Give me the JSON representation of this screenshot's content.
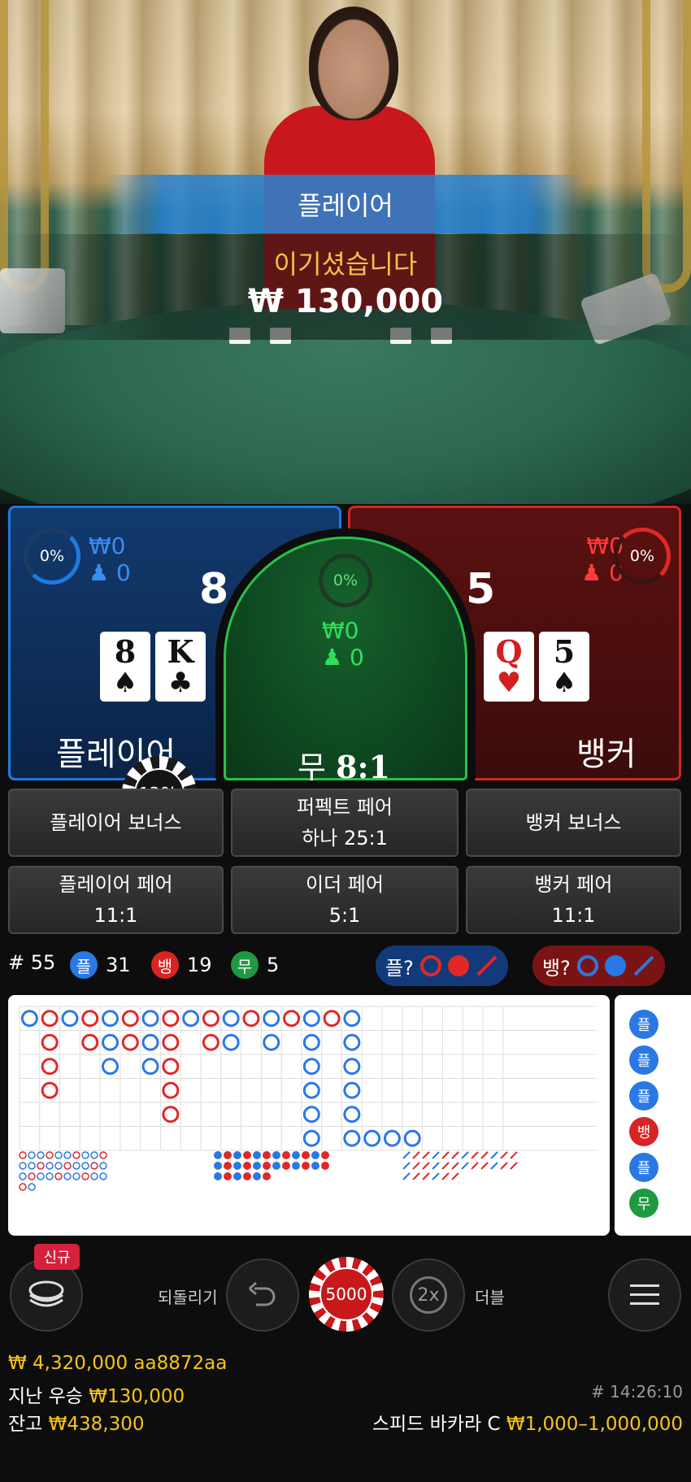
{
  "video": {
    "winner_banner": "플레이어",
    "win_label": "이기셨습니다",
    "win_amount": "₩ 130,000"
  },
  "player_panel": {
    "percent": "0%",
    "amount": "₩0",
    "players": "0",
    "score": "8",
    "cards": [
      {
        "rank": "8",
        "suit": "♠",
        "color": "black"
      },
      {
        "rank": "K",
        "suit": "♣",
        "color": "black"
      }
    ],
    "label": "플레이어",
    "color": "#1f7ae0"
  },
  "tie_panel": {
    "percent": "0%",
    "amount": "₩0",
    "players": "0",
    "label": "무",
    "payout": "8:1",
    "color": "#25c24a"
  },
  "banker_panel": {
    "percent": "0%",
    "amount": "₩0",
    "players": "0",
    "score": "5",
    "cards": [
      {
        "rank": "Q",
        "suit": "♥",
        "color": "red"
      },
      {
        "rank": "5",
        "suit": "♠",
        "color": "black"
      }
    ],
    "label": "뱅커",
    "color": "#d32626"
  },
  "placed_chip": "130k",
  "side_bets": [
    {
      "line1": "플레이어 보너스",
      "line2": ""
    },
    {
      "line1": "퍼펙트 페어",
      "line2": "하나 25:1"
    },
    {
      "line1": "뱅커 보너스",
      "line2": ""
    },
    {
      "line1": "플레이어 페어",
      "line2": "11:1"
    },
    {
      "line1": "이더 페어",
      "line2": "5:1"
    },
    {
      "line1": "뱅커 페어",
      "line2": "11:1"
    }
  ],
  "summary": {
    "round": "# 55",
    "player_glyph": "플",
    "player_count": "31",
    "banker_glyph": "뱅",
    "banker_count": "19",
    "tie_glyph": "무",
    "tie_count": "5",
    "predict_player": "플?",
    "predict_banker": "뱅?"
  },
  "side_road": [
    "플",
    "플",
    "플",
    "뱅",
    "플",
    "무"
  ],
  "controls": {
    "new_badge": "신규",
    "undo_label": "되돌리기",
    "chip_value": "5000",
    "double_icon": "2x",
    "double_label": "더블"
  },
  "footer": {
    "win_total": "₩ 4,320,000",
    "user_id": "aa8872aa",
    "last_win_label": "지난 우승",
    "last_win_value": "₩130,000",
    "balance_label": "잔고",
    "balance_value": "₩438,300",
    "round_time": "# 14:26:10",
    "table_name": "스피드 바카라 C",
    "limits": "₩1,000–1,000,000"
  }
}
